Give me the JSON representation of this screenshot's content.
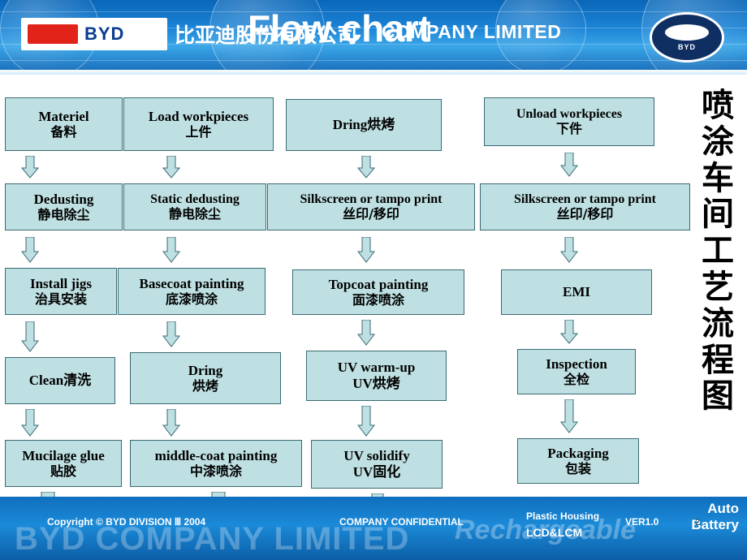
{
  "header": {
    "title": "Flow chart",
    "logo_text": "BYD",
    "company_cn": "比亚迪股份有限公司",
    "company_en": "COMPANY LIMITED",
    "badge_name": "BYD"
  },
  "vertical_title": [
    "喷",
    "涂",
    "车",
    "间",
    "工",
    "艺",
    "流",
    "程",
    "图"
  ],
  "flow": {
    "nodes": [
      {
        "id": "n1",
        "en": "Materiel",
        "cn": "备料"
      },
      {
        "id": "n2",
        "en": "Load workpieces",
        "cn": "上件"
      },
      {
        "id": "n3",
        "en": "Dring烘烤",
        "cn": ""
      },
      {
        "id": "n4",
        "en": "Unload workpieces",
        "cn": "下件"
      },
      {
        "id": "n5",
        "en": "Dedusting",
        "cn": "静电除尘"
      },
      {
        "id": "n6",
        "en": "Static dedusting",
        "cn": "静电除尘"
      },
      {
        "id": "n7",
        "en": "Silkscreen or tampo print",
        "cn": "丝印/移印"
      },
      {
        "id": "n8",
        "en": "Silkscreen or tampo print",
        "cn": "丝印/移印"
      },
      {
        "id": "n9",
        "en": "Install jigs",
        "cn": "治具安装"
      },
      {
        "id": "n10",
        "en": "Basecoat painting",
        "cn": "底漆喷涂"
      },
      {
        "id": "n11",
        "en": "Topcoat painting",
        "cn": "面漆喷涂"
      },
      {
        "id": "n12",
        "en": "EMI",
        "cn": ""
      },
      {
        "id": "n13",
        "en": "Clean清洗",
        "cn": ""
      },
      {
        "id": "n14",
        "en": "Dring",
        "cn": "烘烤"
      },
      {
        "id": "n15",
        "en": "UV warm-up",
        "cn": "UV烘烤"
      },
      {
        "id": "n16",
        "en": "Inspection",
        "cn": "全检"
      },
      {
        "id": "n17",
        "en": "Mucilage glue",
        "cn": "贴胶"
      },
      {
        "id": "n18",
        "en": "middle-coat painting",
        "cn": "中漆喷涂"
      },
      {
        "id": "n19",
        "en": "UV solidify",
        "cn": "UV固化"
      },
      {
        "id": "n20",
        "en": "Packaging",
        "cn": "包装"
      }
    ],
    "arrow_count": 18
  },
  "footer": {
    "ghost_left": "BYD COMPANY LIMITED",
    "ghost_right": "Rechargeable",
    "copyright": "Copyright © BYD  DIVISION  Ⅲ 2004",
    "confidential": "COMPANY  CONFIDENTIAL",
    "version": "VER1.0",
    "plastic_housing": "Plastic Housing",
    "lcd_lcm": "LCD&LCM",
    "auto": "Auto",
    "battery": "Battery",
    "page_number": "2"
  }
}
